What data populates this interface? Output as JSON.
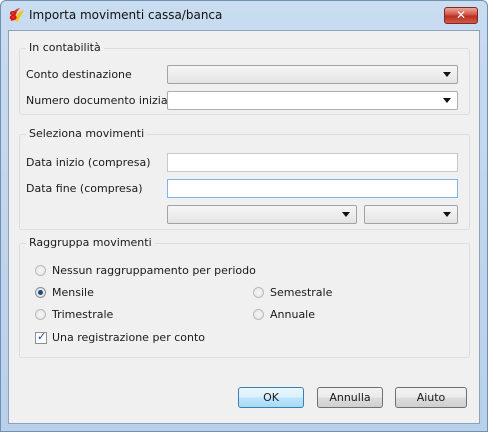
{
  "window": {
    "title": "Importa movimenti cassa/banca",
    "close_glyph": "✕",
    "app_icon": "banana-app-icon"
  },
  "in_contabilita": {
    "title": "In contabilità",
    "conto_label": "Conto destinazione",
    "conto_value": "",
    "numero_label": "Numero documento iniziale",
    "numero_value": ""
  },
  "seleziona": {
    "title": "Seleziona movimenti",
    "data_inizio_label": "Data inizio (compresa)",
    "data_inizio_value": "",
    "data_fine_label": "Data fine (compresa)",
    "data_fine_value": "",
    "period_value": "",
    "year_value": ""
  },
  "raggruppa": {
    "title": "Raggruppa movimenti",
    "options": {
      "nessuno": "Nessun raggruppamento per periodo",
      "mensile": "Mensile",
      "semestrale": "Semestrale",
      "trimestrale": "Trimestrale",
      "annuale": "Annuale"
    },
    "selected": "Mensile",
    "checkbox_label": "Una registrazione per conto",
    "checkbox_checked": true
  },
  "buttons": {
    "ok": "OK",
    "annulla": "Annulla",
    "aiuto": "Aiuto"
  }
}
